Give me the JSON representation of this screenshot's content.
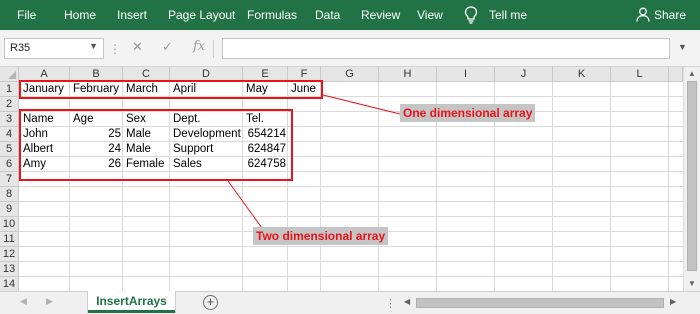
{
  "ribbon": {
    "tabs": [
      "File",
      "Home",
      "Insert",
      "Page Layout",
      "Formulas",
      "Data",
      "Review",
      "View"
    ],
    "tell_me": "Tell me",
    "share": "Share",
    "background_color": "#217346"
  },
  "formula_bar": {
    "name_box": "R35",
    "fx_label": "fx",
    "formula": ""
  },
  "columns": [
    "A",
    "B",
    "C",
    "D",
    "E",
    "F",
    "G",
    "H",
    "I",
    "J",
    "K",
    "L"
  ],
  "rows": [
    "1",
    "2",
    "3",
    "4",
    "5",
    "6",
    "7",
    "8",
    "9",
    "10",
    "11",
    "12",
    "13",
    "14"
  ],
  "cells": {
    "r1": [
      "January",
      "February",
      "March",
      "April",
      "May",
      "June"
    ],
    "header": [
      "Name",
      "Age",
      "Sex",
      "Dept.",
      "Tel."
    ],
    "people": [
      {
        "name": "John",
        "age": "25",
        "sex": "Male",
        "dept": "Development",
        "tel": "654214"
      },
      {
        "name": "Albert",
        "age": "24",
        "sex": "Male",
        "dept": "Support",
        "tel": "624847"
      },
      {
        "name": "Amy",
        "age": "26",
        "sex": "Female",
        "dept": "Sales",
        "tel": "624758"
      }
    ]
  },
  "annotations": {
    "one_dimensional": "One dimensional array",
    "two_dimensional": "Two dimensional array",
    "highlight_color": "#e8141c"
  },
  "sheet_tabs": {
    "active": "InsertArrays"
  }
}
